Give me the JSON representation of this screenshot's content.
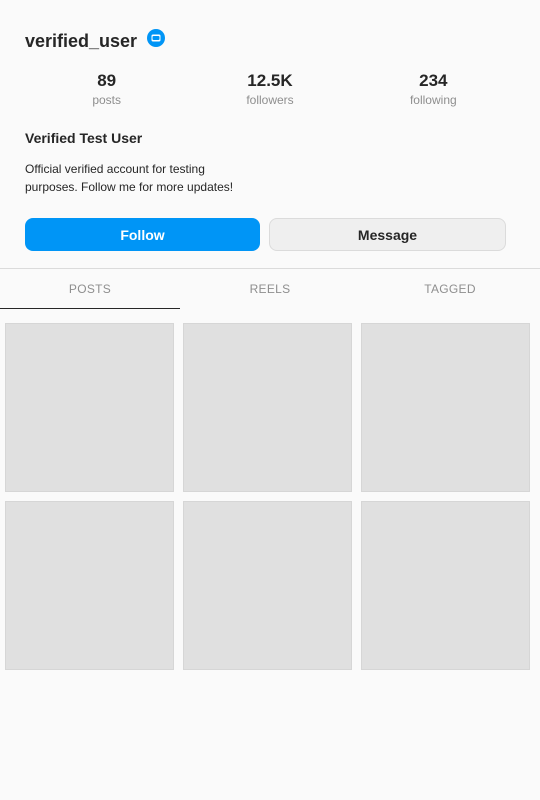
{
  "profile": {
    "username": "verified_user",
    "display_name": "Verified Test User",
    "bio_line1": "Official verified account for testing",
    "bio_line2": "purposes. Follow me for more updates!",
    "verified_badge_icon": "verified-badge-icon",
    "accent_color": "#0095f6"
  },
  "stats": [
    {
      "value": "89",
      "label": "posts"
    },
    {
      "value": "12.5K",
      "label": "followers"
    },
    {
      "value": "234",
      "label": "following"
    }
  ],
  "actions": {
    "follow_label": "Follow",
    "message_label": "Message"
  },
  "tabs": [
    {
      "label": "POSTS",
      "active": true
    },
    {
      "label": "REELS",
      "active": false
    },
    {
      "label": "TAGGED",
      "active": false
    }
  ],
  "posts": {
    "count_visible": 6
  }
}
